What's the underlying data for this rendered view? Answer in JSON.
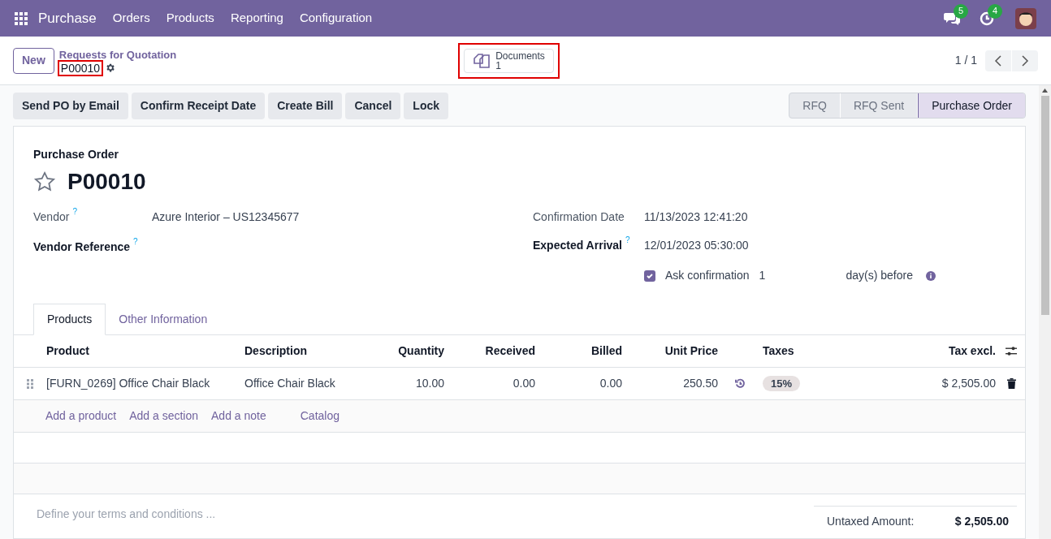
{
  "navbar": {
    "app_name": "Purchase",
    "menu": [
      "Orders",
      "Products",
      "Reporting",
      "Configuration"
    ],
    "messages_count": "5",
    "activities_count": "4"
  },
  "control_panel": {
    "new_button": "New",
    "breadcrumb": "Requests for Quotation",
    "record_name": "P00010",
    "record_name_highlighted": true,
    "documents": {
      "label": "Documents",
      "count": "1",
      "highlighted": true
    },
    "pager": "1 / 1"
  },
  "actions": [
    "Send PO by Email",
    "Confirm Receipt Date",
    "Create Bill",
    "Cancel",
    "Lock"
  ],
  "status_steps": [
    {
      "label": "RFQ",
      "selected": false
    },
    {
      "label": "RFQ Sent",
      "selected": false
    },
    {
      "label": "Purchase Order",
      "selected": true
    }
  ],
  "form": {
    "subtitle": "Purchase Order",
    "title": "P00010",
    "favorite": false,
    "left_fields": [
      {
        "label": "Vendor",
        "bold": false,
        "help": "?",
        "value": "Azure Interior – US12345677"
      },
      {
        "label": "Vendor Reference",
        "bold": true,
        "help": "?"
      }
    ],
    "right_fields": [
      {
        "label": "Confirmation Date",
        "bold": false,
        "value": "11/13/2023 12:41:20"
      },
      {
        "label": "Expected Arrival",
        "bold": true,
        "help": "?",
        "value": "12/01/2023 05:30:00"
      }
    ],
    "ask_confirmation": {
      "checked": true,
      "label": "Ask confirmation",
      "days": "1",
      "suffix": "day(s) before"
    }
  },
  "tabs": [
    {
      "label": "Products",
      "selected": true
    },
    {
      "label": "Other Information",
      "selected": false
    }
  ],
  "table": {
    "columns": [
      "Product",
      "Description",
      "Quantity",
      "Received",
      "Billed",
      "Unit Price",
      "Taxes",
      "Tax excl."
    ],
    "rows": [
      {
        "product": "[FURN_0269] Office Chair Black",
        "description": "Office Chair Black",
        "quantity": "10.00",
        "received": "0.00",
        "billed": "0.00",
        "unit_price": "250.50",
        "taxes": [
          "15%"
        ],
        "subtotal": "$ 2,505.00"
      }
    ],
    "add_links": [
      "Add a product",
      "Add a section",
      "Add a note",
      "Catalog"
    ]
  },
  "terms_placeholder": "Define your terms and conditions ...",
  "totals": [
    {
      "label": "Untaxed Amount:",
      "value": "$ 2,505.00"
    }
  ]
}
